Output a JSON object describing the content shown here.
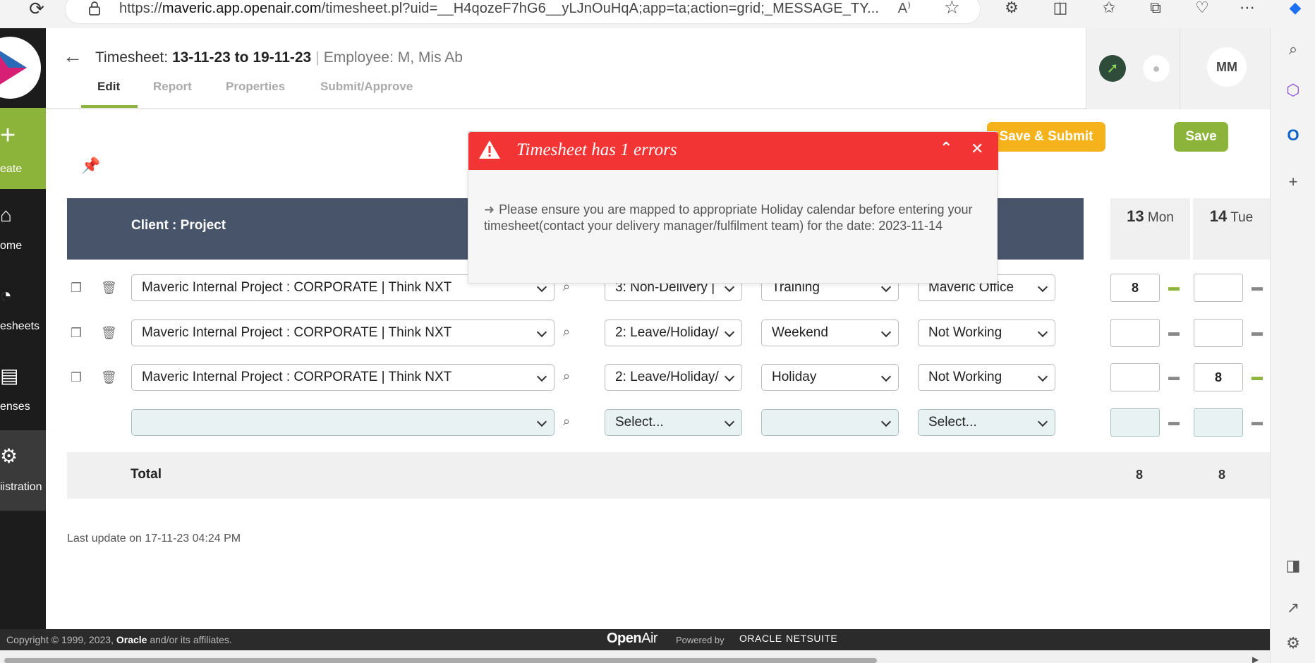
{
  "browser": {
    "url_prefix": "https://",
    "url_host": "maveric.app.openair.com",
    "url_rest": "/timesheet.pl?uid=__H4qozeF7hG6__yLJnOuHqA;app=ta;action=grid;_MESSAGE_TY..."
  },
  "nav": {
    "create_label": "eate",
    "items": [
      {
        "label": "ome",
        "icon": "home-icon"
      },
      {
        "label": "esheets",
        "icon": "clock-icon"
      },
      {
        "label": "enses",
        "icon": "wallet-icon"
      },
      {
        "label": "iistration",
        "icon": "gear-icon"
      }
    ]
  },
  "header": {
    "title_prefix": "Timesheet: ",
    "date_range": "13-11-23 to 19-11-23",
    "separator": "|",
    "employee": "Employee: M, Mis Ab",
    "tabs": [
      "Edit",
      "Report",
      "Properties",
      "Submit/Approve"
    ],
    "active_tab": "Edit",
    "avatar": "MM"
  },
  "actions": {
    "save_submit": "Save & Submit",
    "save": "Save"
  },
  "grid": {
    "column_header": "Client : Project",
    "days": [
      {
        "num": "13",
        "name": "Mon"
      },
      {
        "num": "14",
        "name": "Tue"
      }
    ],
    "rows": [
      {
        "project": "Maveric Internal Project : CORPORATE | Think NXT",
        "task": "3: Non-Delivery | ",
        "type": "Training",
        "location": "Maveric Office",
        "mon": "8",
        "tue": ""
      },
      {
        "project": "Maveric Internal Project : CORPORATE | Think NXT",
        "task": "2: Leave/Holiday/",
        "type": "Weekend",
        "location": "Not Working",
        "mon": "",
        "tue": ""
      },
      {
        "project": "Maveric Internal Project : CORPORATE | Think NXT",
        "task": "2: Leave/Holiday/",
        "type": "Holiday",
        "location": "Not Working",
        "mon": "",
        "tue": "8"
      },
      {
        "project": "",
        "task": "Select...",
        "type": "",
        "location": "Select...",
        "mon": "",
        "tue": ""
      }
    ],
    "total_label": "Total",
    "totals": [
      "8",
      "8"
    ]
  },
  "last_update": "Last update on 17-11-23 04:24 PM",
  "error_dialog": {
    "title": "Timesheet has 1 errors",
    "message": "Please ensure you are mapped to appropriate Holiday calendar before entering your timesheet(contact your delivery manager/fulfilment team) for the date: 2023-11-14"
  },
  "footer": {
    "copyright_pre": "Copyright © 1999, 2023, ",
    "copyright_brand": "Oracle",
    "copyright_post": " and/or its affiliates.",
    "openair_bold": "Open",
    "openair_rest": "Air",
    "powered_by": "Powered by",
    "oracle": "ORACLE",
    "netsuite": "NETSUITE"
  },
  "colors": {
    "accent_green": "#8cb43a",
    "submit_orange": "#f6b21b",
    "error_red": "#f23434",
    "grid_header": "#485469"
  }
}
